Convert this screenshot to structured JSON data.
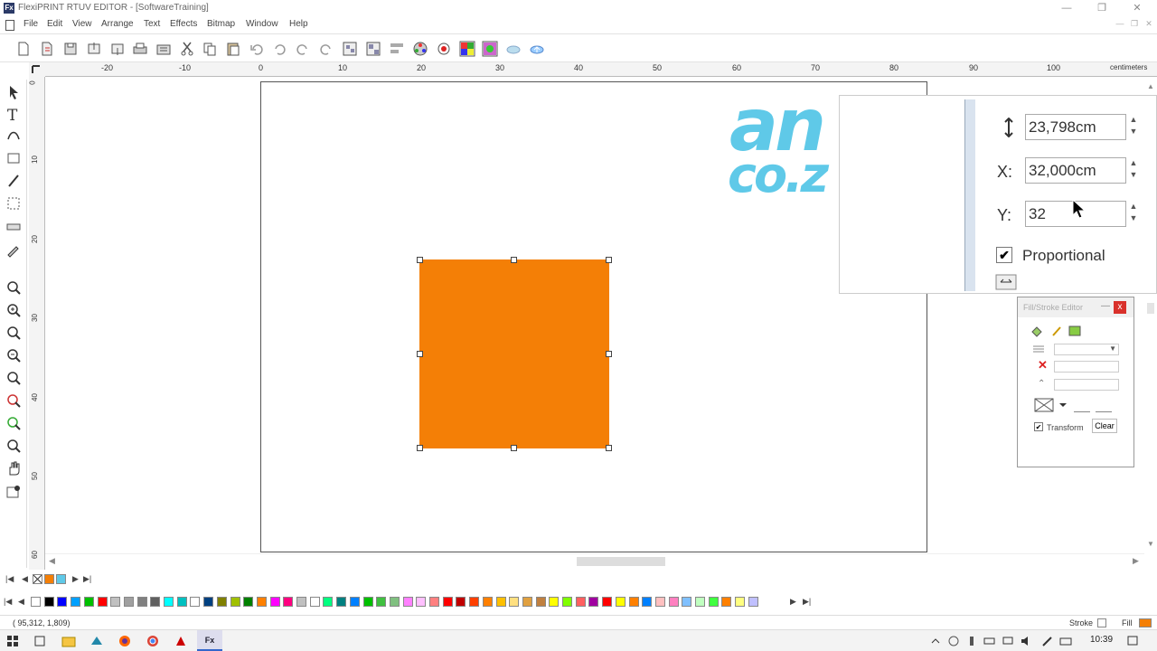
{
  "titlebar": {
    "title": "FlexiPRINT RTUV EDITOR - [SoftwareTraining]",
    "app_icon": "Fx"
  },
  "menubar": {
    "items": [
      "File",
      "Edit",
      "View",
      "Arrange",
      "Text",
      "Effects",
      "Bitmap",
      "Window",
      "Help"
    ]
  },
  "ruler": {
    "top_labels": [
      "-20",
      "-10",
      "0",
      "10",
      "20",
      "30",
      "40",
      "50",
      "60",
      "70",
      "80",
      "90",
      "100"
    ],
    "unit": "centimeters",
    "left_labels": [
      "0",
      "10",
      "20",
      "30",
      "40",
      "50",
      "60"
    ]
  },
  "canvas": {
    "logo_line1": "an",
    "logo_line2": "co.z"
  },
  "transform_panel": {
    "height_value": "23,798cm",
    "x_label": "X:",
    "x_value": "32,000cm",
    "y_label": "Y:",
    "y_value": "32",
    "proportional_label": "Proportional",
    "proportional_checked": "✔"
  },
  "fill_stroke_editor": {
    "title": "Fill/Stroke Editor",
    "close": "x",
    "transform_label": "Transform",
    "transform_checked": "✔",
    "clear_button": "Clear"
  },
  "statusbar": {
    "coords": "( 95,312,   1,809)",
    "stroke_label": "Stroke",
    "fill_label": "Fill"
  },
  "taskbar": {
    "app_label": "Fx",
    "clock": "10:39"
  },
  "colors": {
    "shape_fill": "#f47f06",
    "logo": "#5fc9e8"
  },
  "palette": [
    "#ffffff",
    "#000000",
    "#0000ff",
    "#00a0ff",
    "#00c000",
    "#ff0000",
    "#c0c0c0",
    "#a0a0a0",
    "#808080",
    "#606060",
    "#00ffff",
    "#00c0c0",
    "#ffffff",
    "#004080",
    "#808000",
    "#a0c000",
    "#008000",
    "#ff8000",
    "#ff00ff",
    "#ff0080",
    "#c0c0c0",
    "#ffffff",
    "#00ff80",
    "#008080",
    "#0080ff",
    "#00c000",
    "#40c040",
    "#80c080",
    "#ff80ff",
    "#ffc0ff",
    "#ff8080",
    "#ff0000",
    "#c00000",
    "#ff4000",
    "#ff8000",
    "#ffc000",
    "#ffe080",
    "#e0a040",
    "#c08040",
    "#ffff00",
    "#80ff00",
    "#ff6060",
    "#a000a0",
    "#ff0000",
    "#ffff00",
    "#ff8000",
    "#0080ff",
    "#ffc0c0",
    "#ff80c0",
    "#80c0ff",
    "#c0ffc0",
    "#40ff40",
    "#ff8000",
    "#ffff80",
    "#c0c0ff"
  ]
}
